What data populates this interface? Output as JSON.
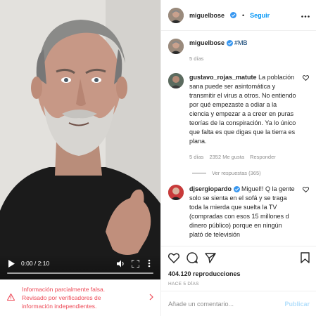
{
  "video": {
    "time": "0:00 / 2:10",
    "progress": 0
  },
  "warning": {
    "line1": "Información parcialmente falsa.",
    "line2": "Revisado por verificadores de",
    "line3": "información independientes."
  },
  "header": {
    "username": "miguelbose",
    "separator": "•",
    "follow_label": "Seguir"
  },
  "comments": [
    {
      "user": "miguelbose",
      "text": "",
      "hashtag": "#MB",
      "meta": [
        "5 días"
      ]
    },
    {
      "user": "gustavo_rojas_matute",
      "text": "La población sana puede ser asintomática y transmitir el virus a otros. No entiendo por qué empezaste a odiar a la ciencia y empezar a a creer en puras teorías de la conspiración. Ya lo único que falta es que digas que la tierra es plana.",
      "meta": [
        "5 días",
        "2352 Me gusta",
        "Responder"
      ],
      "replies": "Ver respuestas (365)"
    },
    {
      "user": "djsergiopardo",
      "text": "Miguel!! Q la gente solo se sienta en el sofá y se traga toda la mierda que suelta la TV (compradas con esos 15 millones d dinero público) porque en ningún plató de televisión"
    }
  ],
  "actions": {
    "views": "404.120 reproducciones",
    "date": "HACE 5 DÍAS"
  },
  "add_comment": {
    "placeholder": "Añade un comentario...",
    "publish_label": "Publicar"
  },
  "colors": {
    "accent": "#0095f6",
    "warning": "#ed4956",
    "muted": "#8e8e8e",
    "publish_disabled": "#b2dffc"
  },
  "icons": [
    "play-icon",
    "volume-icon",
    "fullscreen-icon",
    "more-icon",
    "warning-icon",
    "chevron-right-icon",
    "verified-icon",
    "heart-icon",
    "comment-icon",
    "share-icon",
    "bookmark-icon",
    "options-icon",
    "emoji-icon"
  ]
}
